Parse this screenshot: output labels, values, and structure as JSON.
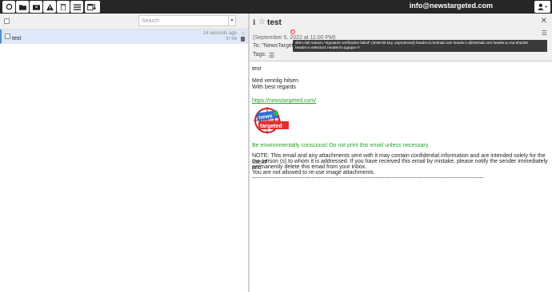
{
  "toolbar": {
    "buttons": [
      "refresh-icon",
      "folder-icon",
      "archive-icon",
      "spam-icon",
      "delete-icon",
      "menu-icon",
      "calendar-icon"
    ],
    "user_email": "info@newstargeted.com"
  },
  "list": {
    "search_placeholder": "Search",
    "items": [
      {
        "subject": "test",
        "time": "14 seconds ago",
        "size": "37 KB"
      }
    ]
  },
  "message": {
    "subject": "test",
    "date": "(September 5, 2022 at 11:00 PM)",
    "to": "To: \"NewsTargeted\"",
    "tags_label": "Tags:",
    "dkim_tooltip": "dkim=fail reason=\"signature verification failed\" (2048-bit key, unprotected) header.d=hotmail.com header.i=@hotmail.com header.a=rsa-sha256 header.s=selector1 header.b=uguqux+7",
    "body": {
      "title": "test",
      "closing": "Med vennlig hilsen",
      "regards": "With best regards",
      "link": "https://newstargeted.com/",
      "logo_text": "news targeted",
      "green_notice": "Be environmentally conscious! Do not print this email unless necessary.",
      "note_1": "NOTE: This email and any attachments sent with it may contain confidential information and are intended solely for the use of",
      "note_2": "the person (s) to whom it is addressed. If you have received this email by mistake, please notify the sender immediately and",
      "note_3": "permanently delete this email from your inbox.",
      "note_4": "You are not allowed to re-use image attachments.",
      "dash_line": "----------------------------------------------------------------------------------------------------------------------------"
    }
  },
  "colors": {
    "topbar": "#262626",
    "selected_row": "#dde8f8",
    "accent_green": "#2aa12a",
    "tooltip_bg": "#3a3a3a"
  }
}
